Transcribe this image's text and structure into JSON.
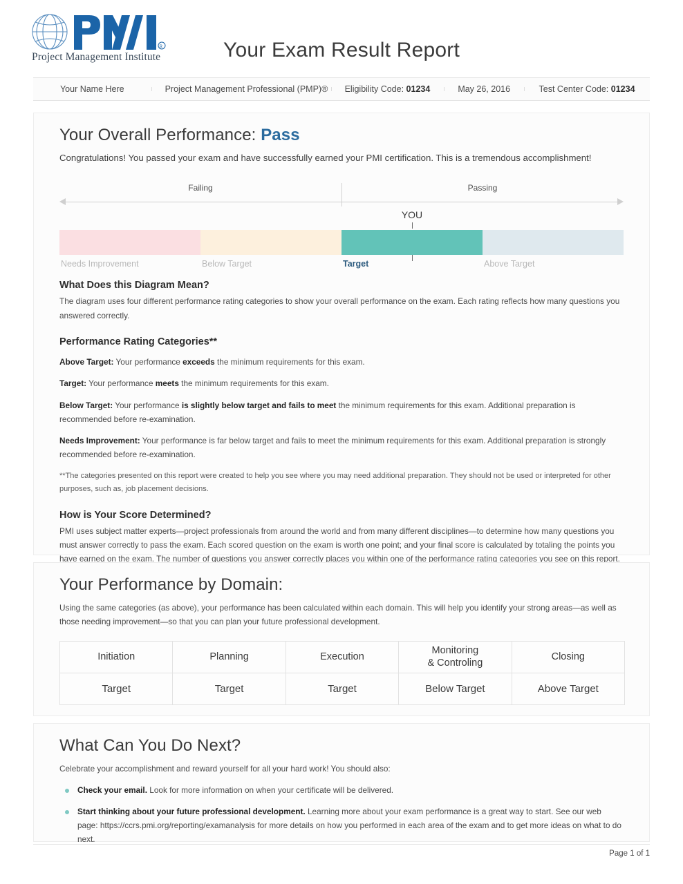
{
  "header": {
    "logo_alt": "pmi-globe-logo",
    "logo_wordmark": "PMI",
    "logo_tagline": "Project Management Institute",
    "report_title": "Your Exam Result Report"
  },
  "info_bar": [
    {
      "label": "",
      "value": "Your Name Here"
    },
    {
      "label": "",
      "value": "Project Management Professional (PMP)®"
    },
    {
      "label": "Eligibility Code:",
      "value": "01234"
    },
    {
      "label": "",
      "value": "May 26, 2016"
    },
    {
      "label": "Test Center Code:",
      "value": "01234"
    }
  ],
  "overall": {
    "title_prefix": "Your Overall Performance:",
    "result": "Pass",
    "congrats": "Congratulations! You passed your exam and have successfully earned your PMI certification. This is a tremendous accomplishment!",
    "scale": {
      "failing_label": "Failing",
      "passing_label": "Passing",
      "you_label": "YOU",
      "you_position_pct": 62.5,
      "bands": [
        {
          "label": "Needs Improvement",
          "color": "#fbdfe2",
          "current": false
        },
        {
          "label": "Below Target",
          "color": "#fdf0dd",
          "current": false
        },
        {
          "label": "Target",
          "color": "#62c3b8",
          "current": true
        },
        {
          "label": "Above Target",
          "color": "#dfe9ee",
          "current": false
        }
      ]
    },
    "diagram_section": {
      "heading": "What Does this Diagram Mean?",
      "text": "The diagram uses four different performance rating categories to show your overall performance on the exam. Each rating reflects how many questions you answered correctly."
    },
    "categories_section": {
      "heading": "Performance Rating Categories**",
      "items": [
        {
          "name": "Above Target:",
          "pre": " Your performance ",
          "strong": "exceeds",
          "post": " the minimum requirements for this exam."
        },
        {
          "name": "Target:",
          "pre": " Your performance ",
          "strong": "meets",
          "post": " the minimum requirements for this exam."
        },
        {
          "name": "Below Target:",
          "pre": " Your performance ",
          "strong": "is slightly below target and fails to meet",
          "post": " the minimum requirements for this exam. Additional preparation is recommended before re-examination."
        },
        {
          "name": "Needs Improvement:",
          "pre": " Your performance is far below target and fails to meet the minimum requirements for this exam. Additional preparation is strongly recommended before re-examination.",
          "strong": "",
          "post": ""
        }
      ],
      "footnote": "**The categories presented on this report were created to help you see where you may need additional preparation. They should not be used or interpreted for other purposes, such as, job placement decisions."
    },
    "score_section": {
      "heading": "How is Your Score Determined?",
      "text": "PMI uses subject matter experts—project professionals from around the world and from many different disciplines—to determine how many questions you must answer correctly to pass the exam. Each scored question on the exam is worth one point; and your final score is calculated by totaling the points you have earned on the exam. The number of questions you answer correctly places you within one of the performance rating categories you see on this report."
    }
  },
  "domain": {
    "title": "Your Performance by Domain:",
    "intro": "Using the same categories (as above), your performance has been calculated within each domain. This will help you identify your strong areas—as well as those needing improvement—so that you can plan your future professional development.",
    "columns": [
      "Initiation",
      "Planning",
      "Execution",
      "Monitoring\n& Controling",
      "Closing"
    ],
    "values": [
      "Target",
      "Target",
      "Target",
      "Below Target",
      "Above Target"
    ]
  },
  "next": {
    "title": "What Can You Do Next?",
    "intro": "Celebrate your accomplishment and reward yourself for all your hard work! You should also:",
    "items": [
      {
        "strong": "Check your email.",
        "rest": " Look for more information on when your certificate will be delivered.",
        "url": "",
        "rest2": ""
      },
      {
        "strong": "Start thinking about your future professional development.",
        "rest": " Learning more about your exam performance is a great way to start. See our web page: ",
        "url": "https://ccrs.pmi.org/reporting/examanalysis",
        "rest2": " for more details on how you performed in each area of the exam and to get more ideas on what to do next."
      }
    ]
  },
  "footer": {
    "page_label": "Page 1 of 1"
  }
}
